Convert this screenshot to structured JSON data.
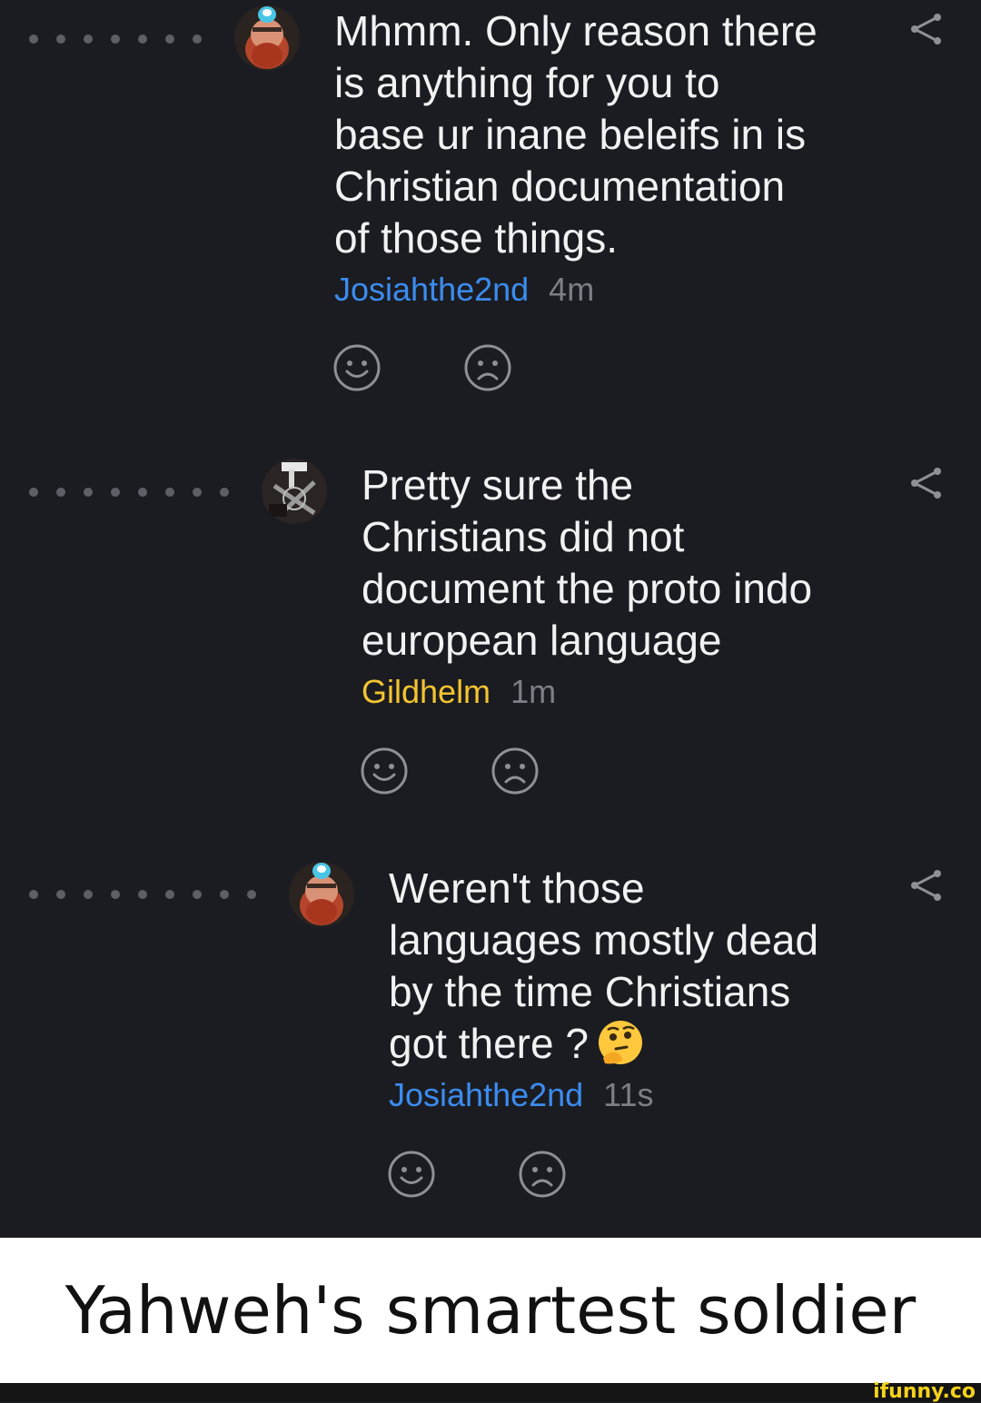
{
  "comments": [
    {
      "text": "Mhmm. Only reason there\nis anything for you to\nbase ur inane beleifs in is\nChristian documentation\nof those things.",
      "username": "Josiahthe2nd",
      "time": "4m",
      "depth": 7,
      "avatar": "bearded-man-avatar",
      "username_color": "#3b8cf0"
    },
    {
      "text": "Pretty sure the\nChristians did not\ndocument the proto indo\neuropean language",
      "username": "Gildhelm",
      "time": "1m",
      "depth": 8,
      "avatar": "dark-emblem-avatar",
      "username_color": "#f4c430"
    },
    {
      "text": "Weren't those\nlanguages mostly dead\nby the time Christians\ngot there ?",
      "username": "Josiahthe2nd",
      "time": "11s",
      "depth": 9,
      "avatar": "bearded-man-avatar",
      "username_color": "#3b8cf0",
      "trailing_emoji": "thinking-face-emoji"
    }
  ],
  "icons": {
    "smile": "smile-icon",
    "frown": "frown-icon",
    "share": "share-icon"
  },
  "caption": "Yahweh's smartest soldier",
  "watermark": "ifunny.co",
  "colors": {
    "background": "#1b1c21",
    "text": "#f2f2f4",
    "meta_time": "#7d7e86"
  }
}
